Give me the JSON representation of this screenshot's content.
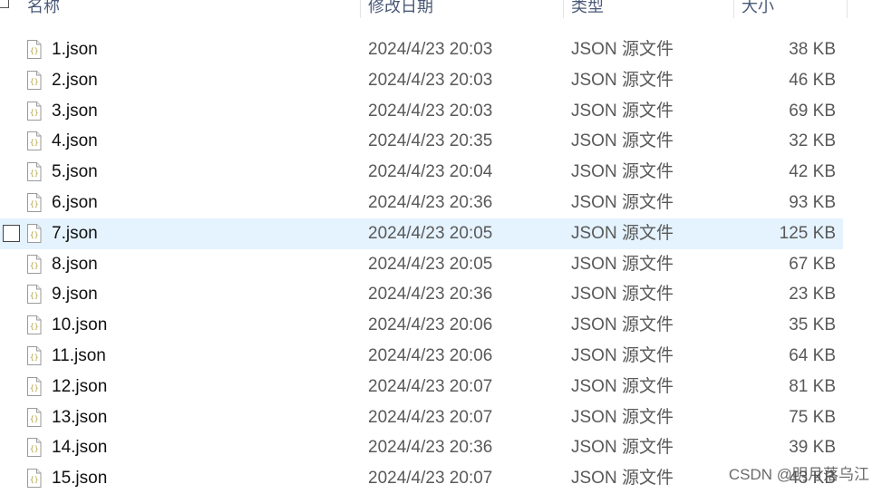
{
  "header": {
    "col_name": "名称",
    "col_date": "修改日期",
    "col_type": "类型",
    "col_size": "大小"
  },
  "files": [
    {
      "name": "1.json",
      "modified": "2024/4/23 20:03",
      "type": "JSON 源文件",
      "size": "38 KB",
      "selected": false
    },
    {
      "name": "2.json",
      "modified": "2024/4/23 20:03",
      "type": "JSON 源文件",
      "size": "46 KB",
      "selected": false
    },
    {
      "name": "3.json",
      "modified": "2024/4/23 20:03",
      "type": "JSON 源文件",
      "size": "69 KB",
      "selected": false
    },
    {
      "name": "4.json",
      "modified": "2024/4/23 20:35",
      "type": "JSON 源文件",
      "size": "32 KB",
      "selected": false
    },
    {
      "name": "5.json",
      "modified": "2024/4/23 20:04",
      "type": "JSON 源文件",
      "size": "42 KB",
      "selected": false
    },
    {
      "name": "6.json",
      "modified": "2024/4/23 20:36",
      "type": "JSON 源文件",
      "size": "93 KB",
      "selected": false
    },
    {
      "name": "7.json",
      "modified": "2024/4/23 20:05",
      "type": "JSON 源文件",
      "size": "125 KB",
      "selected": true
    },
    {
      "name": "8.json",
      "modified": "2024/4/23 20:05",
      "type": "JSON 源文件",
      "size": "67 KB",
      "selected": false
    },
    {
      "name": "9.json",
      "modified": "2024/4/23 20:36",
      "type": "JSON 源文件",
      "size": "23 KB",
      "selected": false
    },
    {
      "name": "10.json",
      "modified": "2024/4/23 20:06",
      "type": "JSON 源文件",
      "size": "35 KB",
      "selected": false
    },
    {
      "name": "11.json",
      "modified": "2024/4/23 20:06",
      "type": "JSON 源文件",
      "size": "64 KB",
      "selected": false
    },
    {
      "name": "12.json",
      "modified": "2024/4/23 20:07",
      "type": "JSON 源文件",
      "size": "81 KB",
      "selected": false
    },
    {
      "name": "13.json",
      "modified": "2024/4/23 20:07",
      "type": "JSON 源文件",
      "size": "75 KB",
      "selected": false
    },
    {
      "name": "14.json",
      "modified": "2024/4/23 20:36",
      "type": "JSON 源文件",
      "size": "39 KB",
      "selected": false
    },
    {
      "name": "15.json",
      "modified": "2024/4/23 20:07",
      "type": "JSON 源文件",
      "size": "43 KB",
      "selected": false
    }
  ],
  "file_icon": "json-file-icon",
  "colors": {
    "selected_row": "#e5f3ff",
    "header_text": "#4a5a78",
    "secondary_text": "#595959"
  },
  "watermark": "CSDN @明月落乌江"
}
